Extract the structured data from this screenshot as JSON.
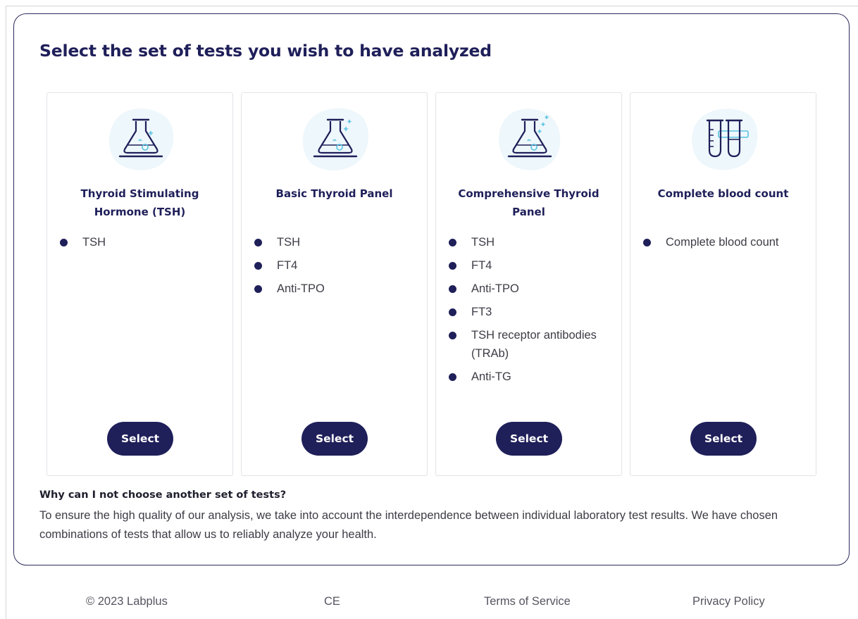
{
  "page": {
    "title": "Select the set of tests you wish to have analyzed"
  },
  "cards": [
    {
      "icon": "flask-icon",
      "title": "Thyroid Stimulating Hormone (TSH)",
      "tests": [
        "TSH"
      ],
      "button": "Select"
    },
    {
      "icon": "flask-icon",
      "title": "Basic Thyroid Panel",
      "tests": [
        "TSH",
        "FT4",
        "Anti-TPO"
      ],
      "button": "Select"
    },
    {
      "icon": "flask-icon",
      "title": "Comprehensive Thyroid Panel",
      "tests": [
        "TSH",
        "FT4",
        "Anti-TPO",
        "FT3",
        "TSH receptor antibodies (TRAb)",
        "Anti-TG"
      ],
      "button": "Select"
    },
    {
      "icon": "test-tubes-icon",
      "title": "Complete blood count",
      "tests": [
        "Complete blood count"
      ],
      "button": "Select"
    }
  ],
  "info": {
    "heading": "Why can I not choose another set of tests?",
    "body": "To ensure the high quality of our analysis, we take into account the interdependence between individual laboratory test results. We have chosen combinations of tests that allow us to reliably analyze your health."
  },
  "footer": {
    "copyright": "© 2023 Labplus",
    "ce": "CE",
    "terms": "Terms of Service",
    "privacy": "Privacy Policy"
  },
  "colors": {
    "primary": "#1f1f5a",
    "icon_blob": "#eef7fb",
    "icon_accent": "#59c3e2"
  }
}
